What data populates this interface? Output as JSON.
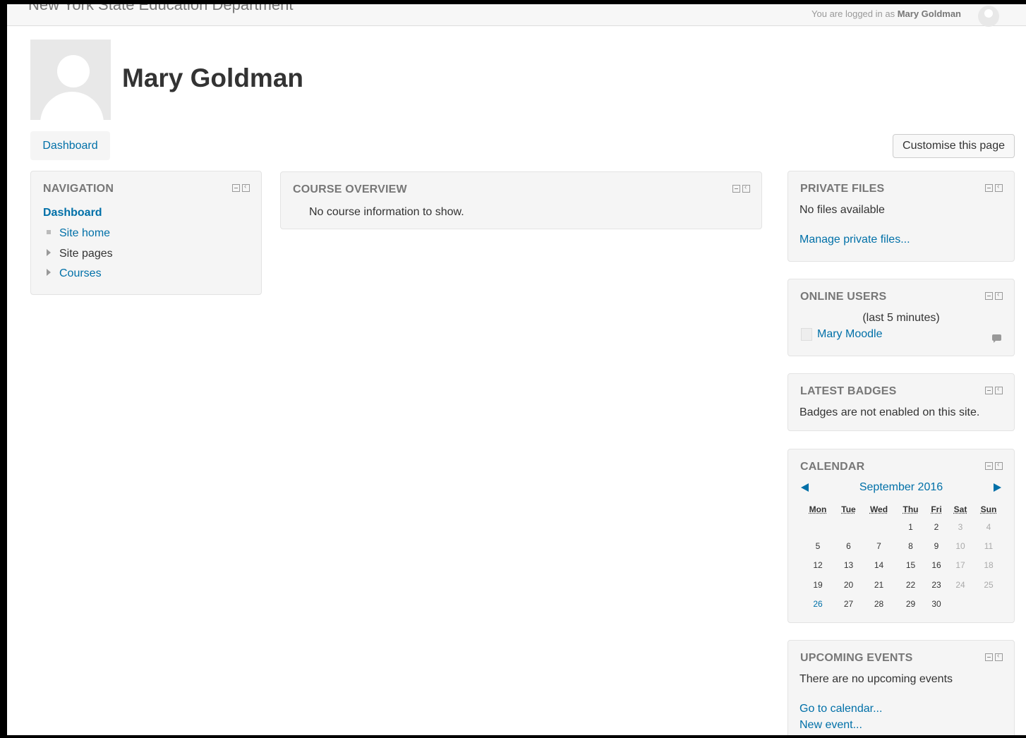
{
  "topbar": {
    "site_name": "New York State Education Department",
    "login_prefix": "You are logged in as",
    "login_user": "Mary Goldman"
  },
  "header": {
    "title": "Mary Goldman",
    "breadcrumb": "Dashboard",
    "customise_label": "Customise this page"
  },
  "navigation": {
    "title": "NAVIGATION",
    "dashboard": "Dashboard",
    "items": [
      {
        "label": "Site home",
        "style": "bullet",
        "link": true
      },
      {
        "label": "Site pages",
        "style": "expand",
        "link": false
      },
      {
        "label": "Courses",
        "style": "expand",
        "link": true
      }
    ]
  },
  "course_overview": {
    "title": "COURSE OVERVIEW",
    "message": "No course information to show."
  },
  "private_files": {
    "title": "PRIVATE FILES",
    "message": "No files available",
    "link": "Manage private files..."
  },
  "online_users": {
    "title": "ONLINE USERS",
    "period": "(last 5 minutes)",
    "user": "Mary Moodle"
  },
  "latest_badges": {
    "title": "LATEST BADGES",
    "message": "Badges are not enabled on this site."
  },
  "calendar": {
    "title": "CALENDAR",
    "month": "September 2016",
    "weekdays": [
      "Mon",
      "Tue",
      "Wed",
      "Thu",
      "Fri",
      "Sat",
      "Sun"
    ],
    "weeks": [
      [
        "",
        "",
        "",
        "1",
        "2",
        "3",
        "4"
      ],
      [
        "5",
        "6",
        "7",
        "8",
        "9",
        "10",
        "11"
      ],
      [
        "12",
        "13",
        "14",
        "15",
        "16",
        "17",
        "18"
      ],
      [
        "19",
        "20",
        "21",
        "22",
        "23",
        "24",
        "25"
      ],
      [
        "26",
        "27",
        "28",
        "29",
        "30",
        "",
        ""
      ]
    ],
    "today": "26"
  },
  "upcoming_events": {
    "title": "UPCOMING EVENTS",
    "message": "There are no upcoming events",
    "link_calendar": "Go to calendar...",
    "link_new_event": "New event..."
  },
  "colors": {
    "link": "#0070a8",
    "block_bg": "#f5f5f5",
    "block_title": "#777777"
  },
  "icons": {
    "block_minimize": "minus-box-icon",
    "block_dock": "dock-box-icon",
    "calendar_prev": "triangle-left-icon",
    "calendar_next": "triangle-right-icon",
    "message": "speech-bubble-icon"
  }
}
